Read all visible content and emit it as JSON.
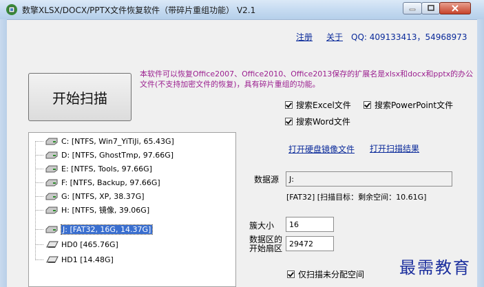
{
  "window": {
    "title": "数擎XLSX/DOCX/PPTX文件恢复软件（带碎片重组功能） V2.1"
  },
  "header": {
    "register": "注册",
    "about": "关于",
    "qq": "QQ: 409133413，54968973"
  },
  "main": {
    "start_scan": "开始扫描",
    "description": "本软件可以恢复Office2007、Office2010、Office2013保存的扩展名是xlsx和docx和pptx的办公文件(不支持加密文件的恢复)，具有碎片重组的功能。"
  },
  "options": {
    "excel": {
      "label": "搜索Excel文件",
      "checked": true
    },
    "ppt": {
      "label": "搜索PowerPoint文件",
      "checked": true
    },
    "word": {
      "label": "搜索Word文件",
      "checked": true
    },
    "unallocated": {
      "label": "仅扫描未分配空间",
      "checked": true
    }
  },
  "links": {
    "open_image": "打开硬盘镜像文件",
    "open_result": "打开扫描结果"
  },
  "drives": [
    {
      "label": "C:  [NTFS, Win7_YiTiJi, 65.43G]",
      "type": "volume"
    },
    {
      "label": "D:  [NTFS, GhostTmp, 97.66G]",
      "type": "volume"
    },
    {
      "label": "E:  [NTFS, Tools, 97.66G]",
      "type": "volume"
    },
    {
      "label": "F:  [NTFS, Backup, 97.66G]",
      "type": "volume"
    },
    {
      "label": "G:  [NTFS, XP, 38.37G]",
      "type": "volume"
    },
    {
      "label": "H:  [NTFS, 镜像, 39.06G]",
      "type": "volume"
    },
    {
      "label": "J:  [FAT32, 16G, 14.37G]",
      "type": "volume",
      "selected": true
    },
    {
      "label": "HD0   [465.76G]",
      "type": "disk"
    },
    {
      "label": "HD1   [14.48G]",
      "type": "disk"
    }
  ],
  "source": {
    "label": "数据源",
    "value": "J:",
    "info": "[FAT32] [扫描目标：剩余空间：10.61G]"
  },
  "cluster": {
    "label": "簇大小",
    "value": "16"
  },
  "data_start": {
    "label_line1": "数据区的",
    "label_line2": "开始扇区",
    "value": "29472"
  },
  "watermark": "最需教育",
  "colors": {
    "accent": "#0a2a9a",
    "description": "#9b1f8f",
    "selection": "#3a6fd0",
    "watermark": "#1c2f9e"
  }
}
